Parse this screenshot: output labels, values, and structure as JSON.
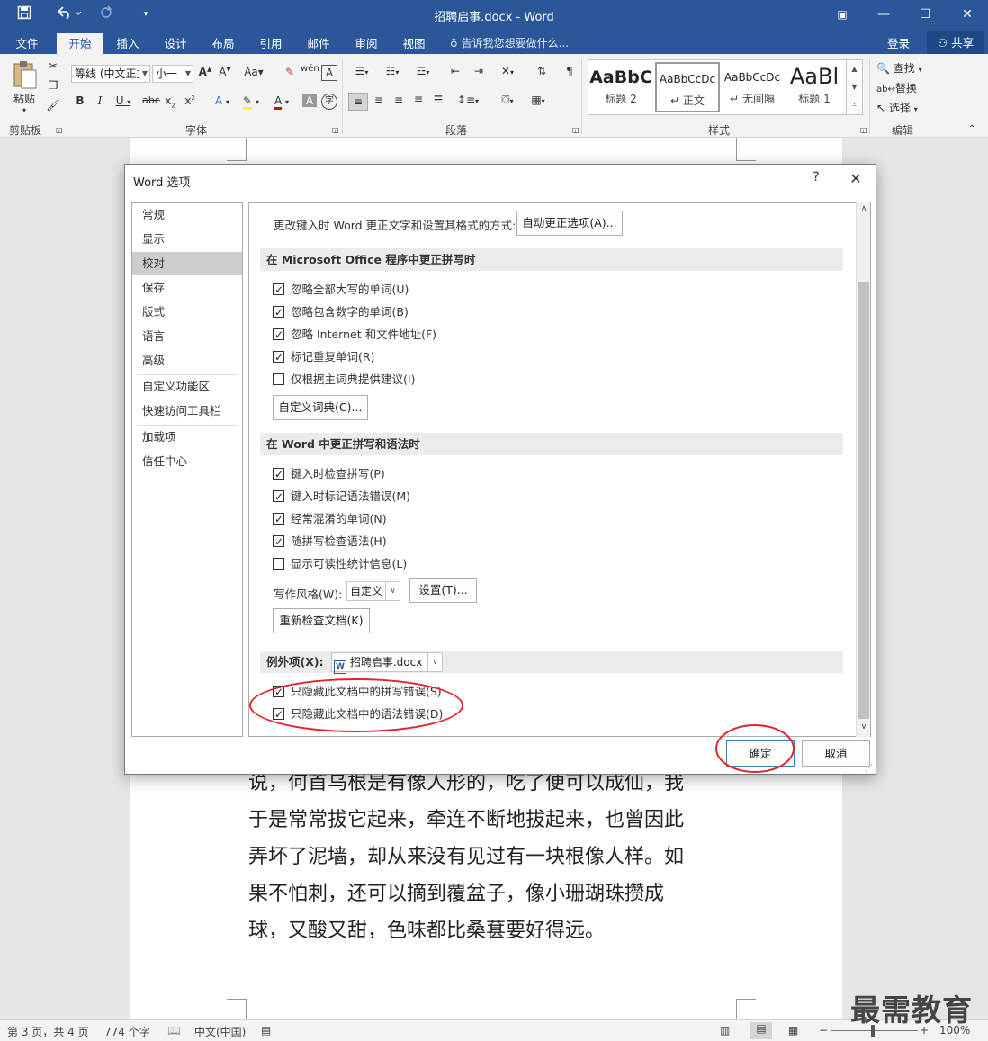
{
  "window": {
    "title": "招聘启事.docx - Word",
    "colors": {
      "titlebar": "#2b579a",
      "accent_red": "#e2242b"
    }
  },
  "quick_access": {
    "save_icon": "save-icon",
    "undo_icon": "undo-icon",
    "redo_icon": "redo-icon",
    "customize_icon": "chevron-down-icon"
  },
  "ribbon_tabs": [
    {
      "label": "文件"
    },
    {
      "label": "开始"
    },
    {
      "label": "插入"
    },
    {
      "label": "设计"
    },
    {
      "label": "布局"
    },
    {
      "label": "引用"
    },
    {
      "label": "邮件"
    },
    {
      "label": "审阅"
    },
    {
      "label": "视图"
    }
  ],
  "tellme": "告诉我您想要做什么...",
  "login": "登录",
  "share": "共享",
  "ribbon": {
    "clipboard": {
      "paste": "粘贴",
      "label": "剪贴板"
    },
    "font": {
      "name": "等线 (中文正文)",
      "size": "小一",
      "label": "字体"
    },
    "paragraph": {
      "label": "段落"
    },
    "styles": {
      "label": "样式",
      "items": [
        {
          "preview": "AaBbC",
          "name": "标题 2"
        },
        {
          "preview": "AaBbCcDc",
          "name": "正文"
        },
        {
          "preview": "AaBbCcDc",
          "name": "无间隔"
        },
        {
          "preview": "AaBl",
          "name": "标题 1"
        }
      ]
    },
    "editing": {
      "find": "查找",
      "replace": "替换",
      "select": "选择",
      "label": "编辑"
    }
  },
  "document": {
    "lines": [
      "说，何首乌根是有像人形的，吃了便可以成仙，我",
      "于是常常拔它起来，牵连不断地拔起来，也曾因此",
      "弄坏了泥墙，却从来没有见过有一块根像人样。如",
      "果不怕刺，还可以摘到覆盆子，像小珊瑚珠攒成",
      "球，又酸又甜，色味都比桑葚要好得远。"
    ]
  },
  "dialog": {
    "title": "Word 选项",
    "nav": [
      {
        "label": "常规"
      },
      {
        "label": "显示"
      },
      {
        "label": "校对"
      },
      {
        "label": "保存"
      },
      {
        "label": "版式"
      },
      {
        "label": "语言"
      },
      {
        "label": "高级"
      },
      {
        "label": "自定义功能区"
      },
      {
        "label": "快速访问工具栏"
      },
      {
        "label": "加载项"
      },
      {
        "label": "信任中心"
      }
    ],
    "autocorrect_desc": "更改键入时 Word 更正文字和设置其格式的方式:",
    "autocorrect_btn": "自动更正选项(A)...",
    "section_office": "在 Microsoft Office 程序中更正拼写时",
    "office_options": [
      {
        "label": "忽略全部大写的单词(U)",
        "checked": true
      },
      {
        "label": "忽略包含数字的单词(B)",
        "checked": true
      },
      {
        "label": "忽略 Internet 和文件地址(F)",
        "checked": true
      },
      {
        "label": "标记重复单词(R)",
        "checked": true
      },
      {
        "label": "仅根据主词典提供建议(I)",
        "checked": false
      }
    ],
    "custom_dict_btn": "自定义词典(C)...",
    "section_word": "在 Word 中更正拼写和语法时",
    "word_options": [
      {
        "label": "键入时检查拼写(P)",
        "checked": true
      },
      {
        "label": "键入时标记语法错误(M)",
        "checked": true
      },
      {
        "label": "经常混淆的单词(N)",
        "checked": true
      },
      {
        "label": "随拼写检查语法(H)",
        "checked": true
      },
      {
        "label": "显示可读性统计信息(L)",
        "checked": false
      }
    ],
    "writing_style_label": "写作风格(W):",
    "writing_style_value": "自定义",
    "settings_btn": "设置(T)...",
    "recheck_btn": "重新检查文档(K)",
    "exceptions_label": "例外项(X):",
    "exceptions_doc": "招聘启事.docx",
    "exception_options": [
      {
        "label": "只隐藏此文档中的拼写错误(S)",
        "checked": true
      },
      {
        "label": "只隐藏此文档中的语法错误(D)",
        "checked": true
      }
    ],
    "ok": "确定",
    "cancel": "取消"
  },
  "status": {
    "page": "第 3 页，共 4 页",
    "words": "774 个字",
    "lang": "中文(中国)",
    "zoom": "100%"
  },
  "watermark": "最需教育"
}
